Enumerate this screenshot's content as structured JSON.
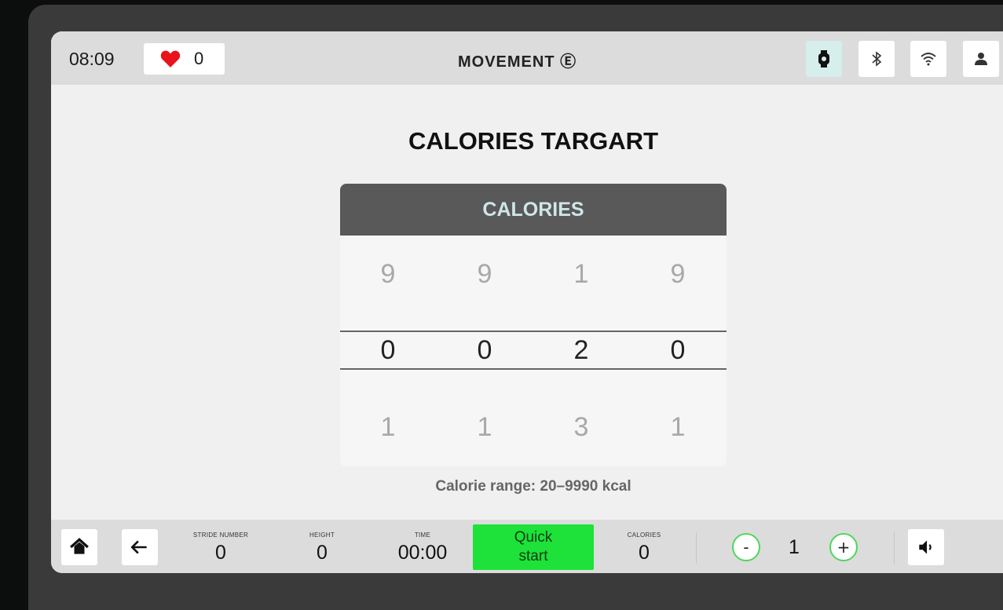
{
  "topbar": {
    "time": "08:09",
    "heart_rate": "0",
    "brand": "MOVEMENT Ⓔ",
    "icons": [
      "watch-icon",
      "bluetooth-icon",
      "wifi-icon",
      "user-icon"
    ]
  },
  "main": {
    "title": "CALORIES TARGART",
    "picker": {
      "header": "CALORIES",
      "prev_row": [
        "9",
        "9",
        "1",
        "9"
      ],
      "selected_row": [
        "0",
        "0",
        "2",
        "0"
      ],
      "next_row": [
        "1",
        "1",
        "3",
        "1"
      ]
    },
    "range_text": "Calorie range: 20–9990 kcal"
  },
  "bottombar": {
    "stride_label": "STRIDE NUMBER",
    "stride_value": "0",
    "height_label": "HEIGHT",
    "height_value": "0",
    "time_label": "TIME",
    "time_value": "00:00",
    "quick_start_line1": "Quick",
    "quick_start_line2": "start",
    "calories_label": "CALORIES",
    "calories_value": "0",
    "minus_label": "-",
    "level_value": "1",
    "plus_label": "+"
  },
  "colors": {
    "quick_start": "#1ee23a",
    "heart": "#e8141b",
    "picker_header": "#595959",
    "circle_border": "#4fd65d"
  }
}
